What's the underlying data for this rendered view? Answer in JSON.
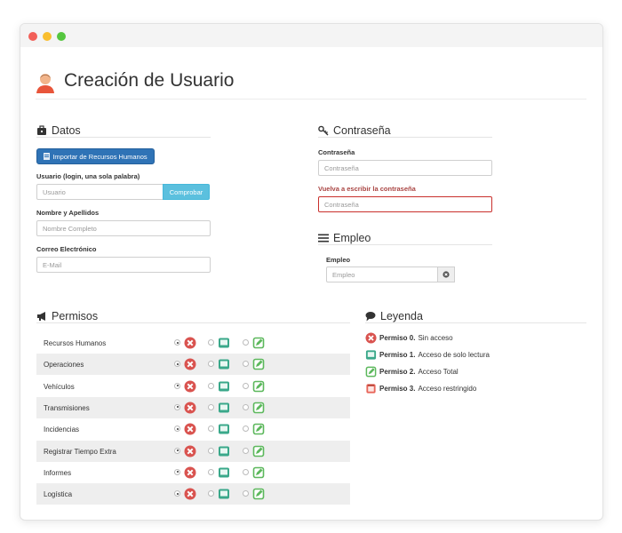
{
  "page": {
    "title": "Creación de Usuario"
  },
  "datos": {
    "heading": "Datos",
    "import_button": "Importar de Recursos Humanos",
    "usuario_label": "Usuario (login, una sola palabra)",
    "usuario_placeholder": "Usuario",
    "check_button": "Comprobar",
    "nombre_label": "Nombre y Apellidos",
    "nombre_placeholder": "Nombre Completo",
    "correo_label": "Correo Electrónico",
    "correo_placeholder": "E-Mail"
  },
  "contrasena": {
    "heading": "Contraseña",
    "pass_label": "Contraseña",
    "pass_placeholder": "Contraseña",
    "repeat_label": "Vuelva a escribir la contraseña",
    "repeat_placeholder": "Contraseña"
  },
  "empleo": {
    "heading": "Empleo",
    "label": "Empleo",
    "placeholder": "Empleo"
  },
  "permisos": {
    "heading": "Permisos",
    "rows": [
      {
        "name": "Recursos Humanos"
      },
      {
        "name": "Operaciones"
      },
      {
        "name": "Vehículos"
      },
      {
        "name": "Transmisiones"
      },
      {
        "name": "Incidencias"
      },
      {
        "name": "Registrar Tiempo Extra"
      },
      {
        "name": "Informes"
      },
      {
        "name": "Logística"
      }
    ]
  },
  "leyenda": {
    "heading": "Leyenda",
    "items": [
      {
        "key": "Permiso 0.",
        "desc": "Sin acceso",
        "color": "#d9534f"
      },
      {
        "key": "Permiso 1.",
        "desc": "Acceso de solo lectura",
        "color": "#3aa88a"
      },
      {
        "key": "Permiso 2.",
        "desc": "Acceso Total",
        "color": "#5cb85c"
      },
      {
        "key": "Permiso 3.",
        "desc": "Acceso restringido",
        "color": "#e8665a"
      }
    ]
  },
  "colors": {
    "primary": "#2f73b6",
    "info": "#5bc0de",
    "error": "#a94442",
    "deny": "#d9534f",
    "read": "#3aa88a",
    "full": "#5cb85c"
  }
}
